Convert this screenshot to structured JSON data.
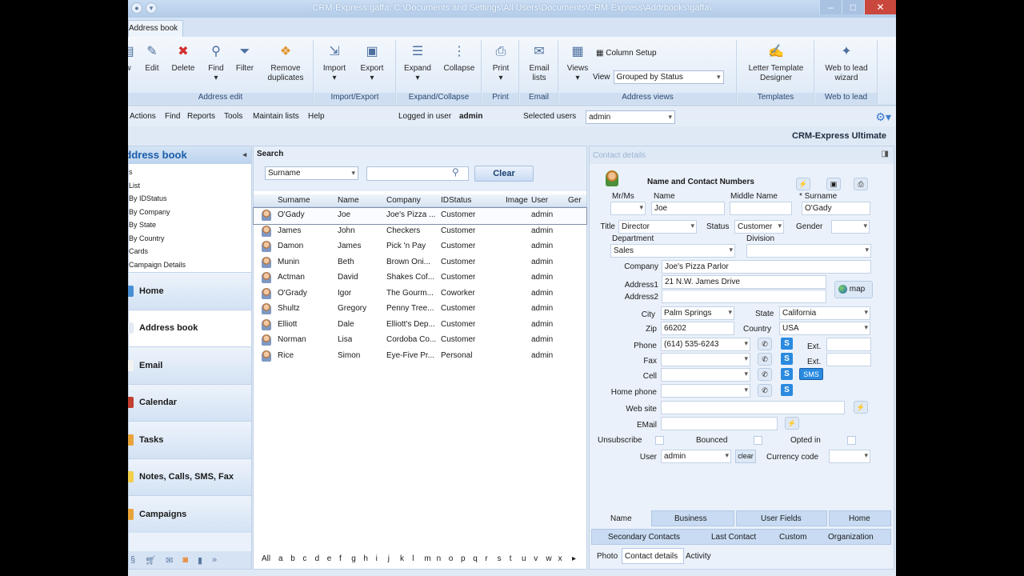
{
  "window": {
    "title": "CRM-Express gaffa: C:\\Documents and Settings\\All Users\\Documents\\CRM-Express\\Addrbooks\\gaffa\\"
  },
  "tab": {
    "label": "Address book"
  },
  "ribbon": {
    "edit": {
      "label": "Edit",
      "delete": "Delete",
      "find": "Find",
      "filter": "Filter",
      "remove_dup": "Remove duplicates",
      "group": "Address edit"
    },
    "io": {
      "import": "Import",
      "export": "Export",
      "group": "Import/Export"
    },
    "ec": {
      "expand": "Expand",
      "collapse": "Collapse",
      "group": "Expand/Collapse"
    },
    "print": {
      "label": "Print",
      "group": "Print"
    },
    "email": {
      "label": "Email lists",
      "group": "Email"
    },
    "views": {
      "label": "Views",
      "column_setup": "Column Setup",
      "view_label": "View",
      "view_value": "Grouped by Status",
      "group": "Address views"
    },
    "templates": {
      "label": "Letter Template Designer",
      "group": "Templates"
    },
    "weblead": {
      "label": "Web to lead wizard",
      "group": "Web to lead"
    }
  },
  "menu": {
    "items": [
      "Actions",
      "Find",
      "Reports",
      "Tools",
      "Maintain lists",
      "Help"
    ],
    "logged_label": "Logged in user",
    "logged_user": "admin",
    "selected_label": "Selected users",
    "selected_value": "admin"
  },
  "edition": "CRM-Express Ultimate",
  "left": {
    "title": "Address book",
    "tree": [
      "s",
      "List",
      "By IDStatus",
      "By Company",
      "By State",
      "By Country",
      "Cards",
      "Campaign Details"
    ],
    "nav": [
      "Home",
      "Address book",
      "Email",
      "Calendar",
      "Tasks",
      "Notes, Calls, SMS, Fax",
      "Campaigns"
    ]
  },
  "search": {
    "title": "Search",
    "field": "Surname",
    "clear": "Clear",
    "columns": [
      "Surname",
      "Name",
      "Company",
      "IDStatus",
      "Image",
      "User",
      "Ger"
    ],
    "rows": [
      [
        "O'Gady",
        "Joe",
        "Joe's Pizza ...",
        "Customer",
        "admin"
      ],
      [
        "James",
        "John",
        "Checkers",
        "Customer",
        "admin"
      ],
      [
        "Damon",
        "James",
        "Pick 'n Pay",
        "Customer",
        "admin"
      ],
      [
        "Munin",
        "Beth",
        "Brown Oni...",
        "Customer",
        "admin"
      ],
      [
        "Actman",
        "David",
        "Shakes Cof...",
        "Customer",
        "admin"
      ],
      [
        "O'Grady",
        "Igor",
        "The Gourm...",
        "Coworker",
        "admin"
      ],
      [
        "Shultz",
        "Gregory",
        "Penny Tree...",
        "Customer",
        "admin"
      ],
      [
        "Elliott",
        "Dale",
        "Elliott's Dep...",
        "Customer",
        "admin"
      ],
      [
        "Norman",
        "Lisa",
        "Cordoba Co...",
        "Customer",
        "admin"
      ],
      [
        "Rice",
        "Simon",
        "Eye-Five Pr...",
        "Personal",
        "admin"
      ]
    ],
    "alphabet": [
      "All",
      "a",
      "b",
      "c",
      "d",
      "e",
      "f",
      "g",
      "h",
      "i",
      "j",
      "k",
      "l",
      "m",
      "n",
      "o",
      "p",
      "q",
      "r",
      "s",
      "t",
      "u",
      "v",
      "w",
      "x"
    ]
  },
  "details": {
    "header": "Contact details",
    "section": "Name and Contact Numbers",
    "labels": {
      "mrms": "Mr/Ms",
      "name": "Name",
      "middle": "Middle Name",
      "surname": "* Surname",
      "title": "Title",
      "status": "Status",
      "gender": "Gender",
      "department": "Department",
      "division": "Division",
      "company": "Company",
      "address1": "Address1",
      "address2": "Address2",
      "city": "City",
      "state": "State",
      "zip": "Zip",
      "country": "Country",
      "phone": "Phone",
      "fax": "Fax",
      "cell": "Cell",
      "home": "Home phone",
      "web": "Web site",
      "email": "EMail",
      "ext": "Ext.",
      "unsub": "Unsubscribe",
      "bounced": "Bounced",
      "optedin": "Opted in",
      "user": "User",
      "currency": "Currency code",
      "map": "map",
      "sms": "SMS",
      "clear": "clear"
    },
    "values": {
      "name": "Joe",
      "surname": "O'Gady",
      "title": "Director",
      "status": "Customer",
      "department": "Sales",
      "company": "Joe's Pizza Parlor",
      "address1": "21 N.W. James Drive",
      "city": "Palm Springs",
      "state": "California",
      "zip": "66202",
      "country": "USA",
      "phone": "(614) 535-6243",
      "user": "admin"
    },
    "tabs1": [
      "Name",
      "Business",
      "User Fields",
      "Home"
    ],
    "tabs2": [
      "Secondary Contacts",
      "Last Contact",
      "Custom",
      "Organization"
    ],
    "tabs3": [
      "Photo",
      "Contact details",
      "Activity"
    ]
  }
}
